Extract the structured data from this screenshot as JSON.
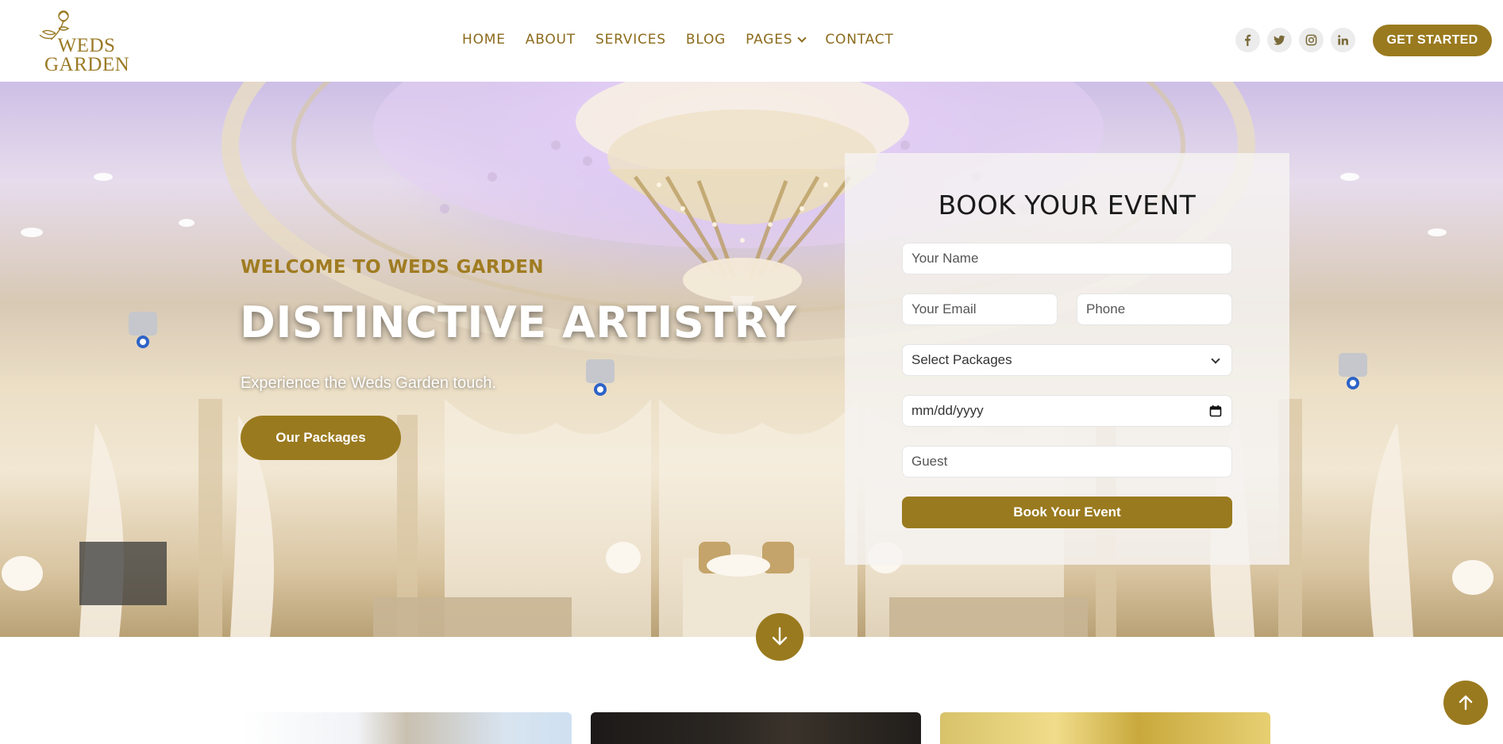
{
  "brand": {
    "name_line1": "WEDS",
    "name_line2": "GARDEN",
    "accent_color": "#9a7a1f"
  },
  "nav": {
    "items": [
      {
        "label": "HOME"
      },
      {
        "label": "ABOUT"
      },
      {
        "label": "SERVICES"
      },
      {
        "label": "BLOG"
      },
      {
        "label": "PAGES",
        "has_dropdown": true
      },
      {
        "label": "CONTACT"
      }
    ]
  },
  "socials": [
    {
      "icon": "facebook-icon"
    },
    {
      "icon": "twitter-icon"
    },
    {
      "icon": "instagram-icon"
    },
    {
      "icon": "linkedin-icon"
    }
  ],
  "header": {
    "cta_label": "GET STARTED"
  },
  "hero": {
    "welcome": "WELCOME TO WEDS GARDEN",
    "headline": "DISTINCTIVE ARTISTRY",
    "subtext": "Experience the Weds Garden touch.",
    "button_label": "Our Packages"
  },
  "booking": {
    "title": "BOOK YOUR EVENT",
    "name_placeholder": "Your Name",
    "email_placeholder": "Your Email",
    "phone_placeholder": "Phone",
    "package_selected": "Select Packages",
    "date_placeholder": "mm/dd/yyyy",
    "guest_placeholder": "Guest",
    "submit_label": "Book Your Event"
  },
  "controls": {
    "scroll_down_icon": "arrow-down-icon",
    "back_to_top_icon": "arrow-up-icon"
  }
}
